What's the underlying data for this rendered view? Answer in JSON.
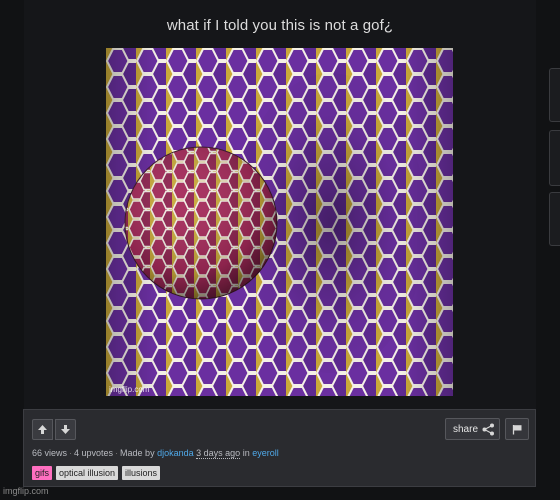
{
  "post": {
    "title": "what if I told you this is not a gof¿",
    "image_watermark": "imgflip.com"
  },
  "actions": {
    "share_label": "share"
  },
  "meta": {
    "views": "66 views",
    "upvotes": "4 upvotes",
    "made_by_prefix": "Made by",
    "author": "djokanda",
    "time_ago": "3 days ago",
    "in_prefix": "in",
    "stream": "eyeroll"
  },
  "tags": [
    {
      "label": "gifs",
      "color": "#ff6fc0"
    },
    {
      "label": "optical illusion",
      "color": "#d9d9d9"
    },
    {
      "label": "illusions",
      "color": "#d9d9d9"
    }
  ],
  "footer": {
    "site": "imgflip.com"
  },
  "colors": {
    "background": "#111214",
    "link": "#4fa8e8",
    "honeycomb_fill": "#6a2fa0",
    "honeycomb_border": "#c9a93a",
    "sphere_fill": "#a52a5a"
  }
}
